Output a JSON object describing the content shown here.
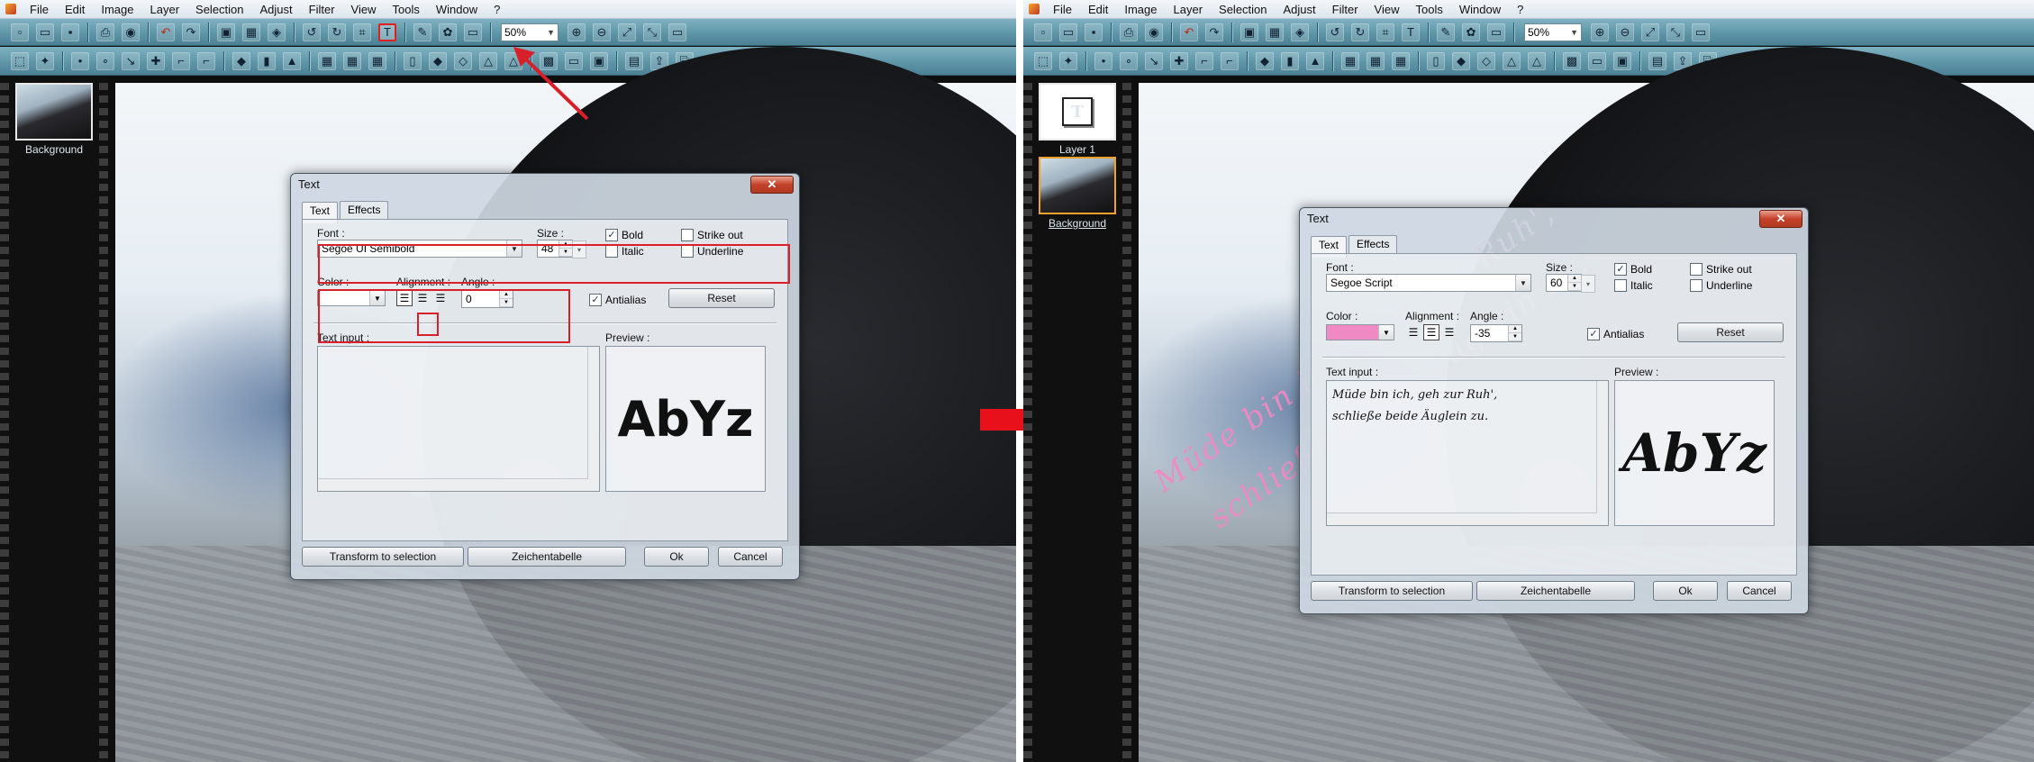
{
  "menu": [
    "File",
    "Edit",
    "Image",
    "Layer",
    "Selection",
    "Adjust",
    "Filter",
    "View",
    "Tools",
    "Window",
    "?"
  ],
  "toolbar": {
    "zoom": "50%",
    "text_tool_glyph": "T"
  },
  "left": {
    "layers": [
      {
        "label": "Background"
      }
    ],
    "dialog": {
      "title": "Text",
      "close": "✕",
      "tabs": [
        "Text",
        "Effects"
      ],
      "font_label": "Font :",
      "font_value": "Segoe UI Semibold",
      "size_label": "Size :",
      "size_value": "48",
      "bold": "Bold",
      "italic": "Italic",
      "strike": "Strike out",
      "underline": "Underline",
      "color_label": "Color :",
      "color_value": "#ffffff",
      "alignment_label": "Alignment :",
      "angle_label": "Angle :",
      "angle_value": "0",
      "antialias": "Antialias",
      "reset": "Reset",
      "text_input_label": "Text input :",
      "text_input_value": "",
      "preview_label": "Preview :",
      "preview_text": "AbYz",
      "transform": "Transform to selection",
      "charmap": "Zeichentabelle",
      "ok": "Ok",
      "cancel": "Cancel"
    }
  },
  "right": {
    "layers": [
      {
        "label": "Layer 1"
      },
      {
        "label": "Background"
      }
    ],
    "overlay_line1": "Müde bin ich, geh zur Ruh',",
    "overlay_line2": "schließe beide Äuglein zu.",
    "dialog": {
      "title": "Text",
      "close": "✕",
      "tabs": [
        "Text",
        "Effects"
      ],
      "font_label": "Font :",
      "font_value": "Segoe Script",
      "size_label": "Size :",
      "size_value": "60",
      "bold": "Bold",
      "italic": "Italic",
      "strike": "Strike out",
      "underline": "Underline",
      "color_label": "Color :",
      "color_value": "#f08ac4",
      "alignment_label": "Alignment :",
      "angle_label": "Angle :",
      "angle_value": "-35",
      "antialias": "Antialias",
      "reset": "Reset",
      "text_input_label": "Text input :",
      "text_input_value": "Müde bin ich, geh zur Ruh',\nschließe beide Äuglein zu.",
      "preview_label": "Preview :",
      "preview_text": "AbYz",
      "transform": "Transform to selection",
      "charmap": "Zeichentabelle",
      "ok": "Ok",
      "cancel": "Cancel"
    }
  },
  "colors": {
    "annotation_red": "#d9202a",
    "pink_text": "#f08ac4",
    "toolbar": "#5e96a8"
  },
  "icons": [
    "new-icon",
    "open-icon",
    "save-icon",
    "print-icon",
    "undo-icon",
    "redo-icon",
    "text-tool-icon",
    "zoom-in-icon",
    "zoom-out-icon",
    "fit-icon"
  ]
}
